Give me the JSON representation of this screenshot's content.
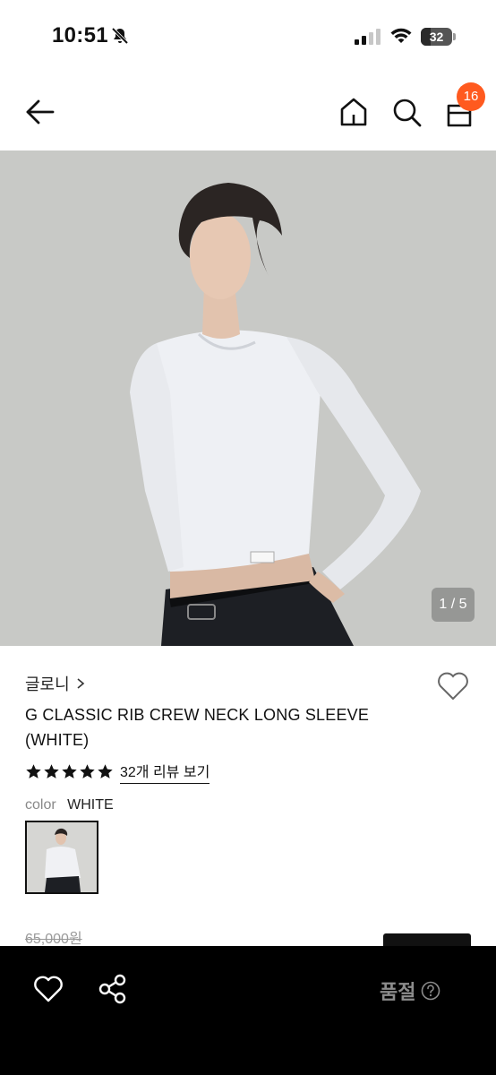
{
  "status_bar": {
    "time": "10:51",
    "battery": "32",
    "battery_level": 0.32
  },
  "nav": {
    "cart_count": "16",
    "icons": [
      "arrow-left-icon",
      "home-icon",
      "search-icon",
      "cart-icon"
    ]
  },
  "gallery": {
    "indicator": "1 / 5",
    "current": 1,
    "total": 5
  },
  "product": {
    "brand": "글로니",
    "title": "G CLASSIC RIB CREW NECK LONG SLEEVE (WHITE)",
    "rating": 5,
    "review_link": "32개 리뷰 보기",
    "color_label": "color",
    "color_value": "WHITE",
    "original_price": "65,000원"
  },
  "bottom_bar": {
    "status": "품절",
    "icons": [
      "heart-icon",
      "share-icon",
      "help-icon"
    ]
  },
  "colors": {
    "badge": "#ff5a1f",
    "bottom_bar_bg": "#000000",
    "soldout_text": "#8c8c8c",
    "image_bg": "#c8c9c6"
  }
}
